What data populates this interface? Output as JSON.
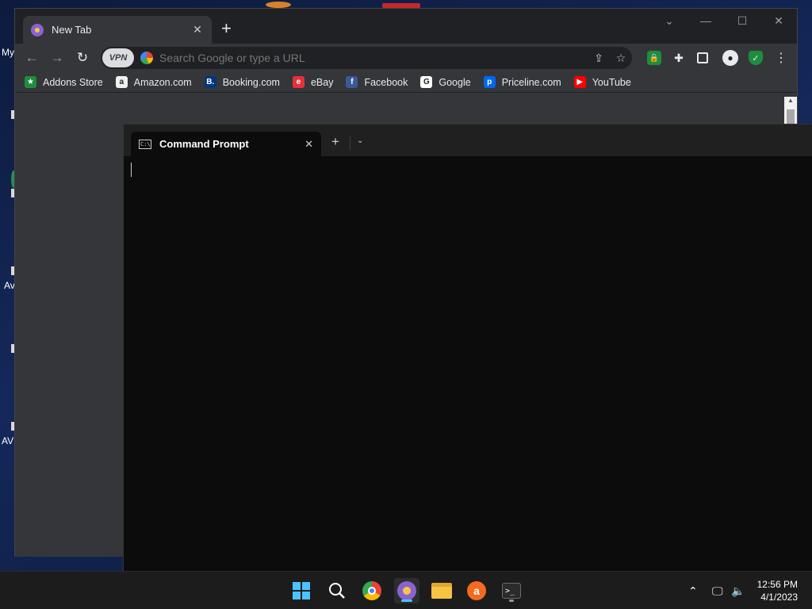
{
  "desktop": {
    "label_my": "My",
    "label_av": "Av",
    "label_avc": "AV"
  },
  "browser": {
    "tab_title": "New Tab",
    "newtab_label": "+",
    "omnibox_placeholder": "Search Google or type a URL",
    "vpn_label": "VPN",
    "bookmarks": [
      {
        "label": "Addons Store",
        "icon": "addons-icon",
        "color": "#1e8e3e",
        "glyph": "★"
      },
      {
        "label": "Amazon.com",
        "icon": "amazon-icon",
        "color": "#f0f0f0",
        "glyph": "a"
      },
      {
        "label": "Booking.com",
        "icon": "booking-icon",
        "color": "#003580",
        "glyph": "B."
      },
      {
        "label": "eBay",
        "icon": "ebay-icon",
        "color": "#e53238",
        "glyph": "e"
      },
      {
        "label": "Facebook",
        "icon": "facebook-icon",
        "color": "#3b5998",
        "glyph": "f"
      },
      {
        "label": "Google",
        "icon": "google-icon",
        "color": "#ffffff",
        "glyph": "G"
      },
      {
        "label": "Priceline.com",
        "icon": "priceline-icon",
        "color": "#0068ef",
        "glyph": "p"
      },
      {
        "label": "YouTube",
        "icon": "youtube-icon",
        "color": "#ff0000",
        "glyph": "▶"
      }
    ]
  },
  "terminal": {
    "tab_title": "Command Prompt",
    "cmd_glyph": "C:\\"
  },
  "taskbar": {
    "time": "12:56 PM",
    "date": "4/1/2023"
  },
  "colors": {
    "accent": "#4cc2ff",
    "browser_bg": "#35363a",
    "tabstrip_bg": "#202124",
    "terminal_bg": "#0c0c0c"
  }
}
